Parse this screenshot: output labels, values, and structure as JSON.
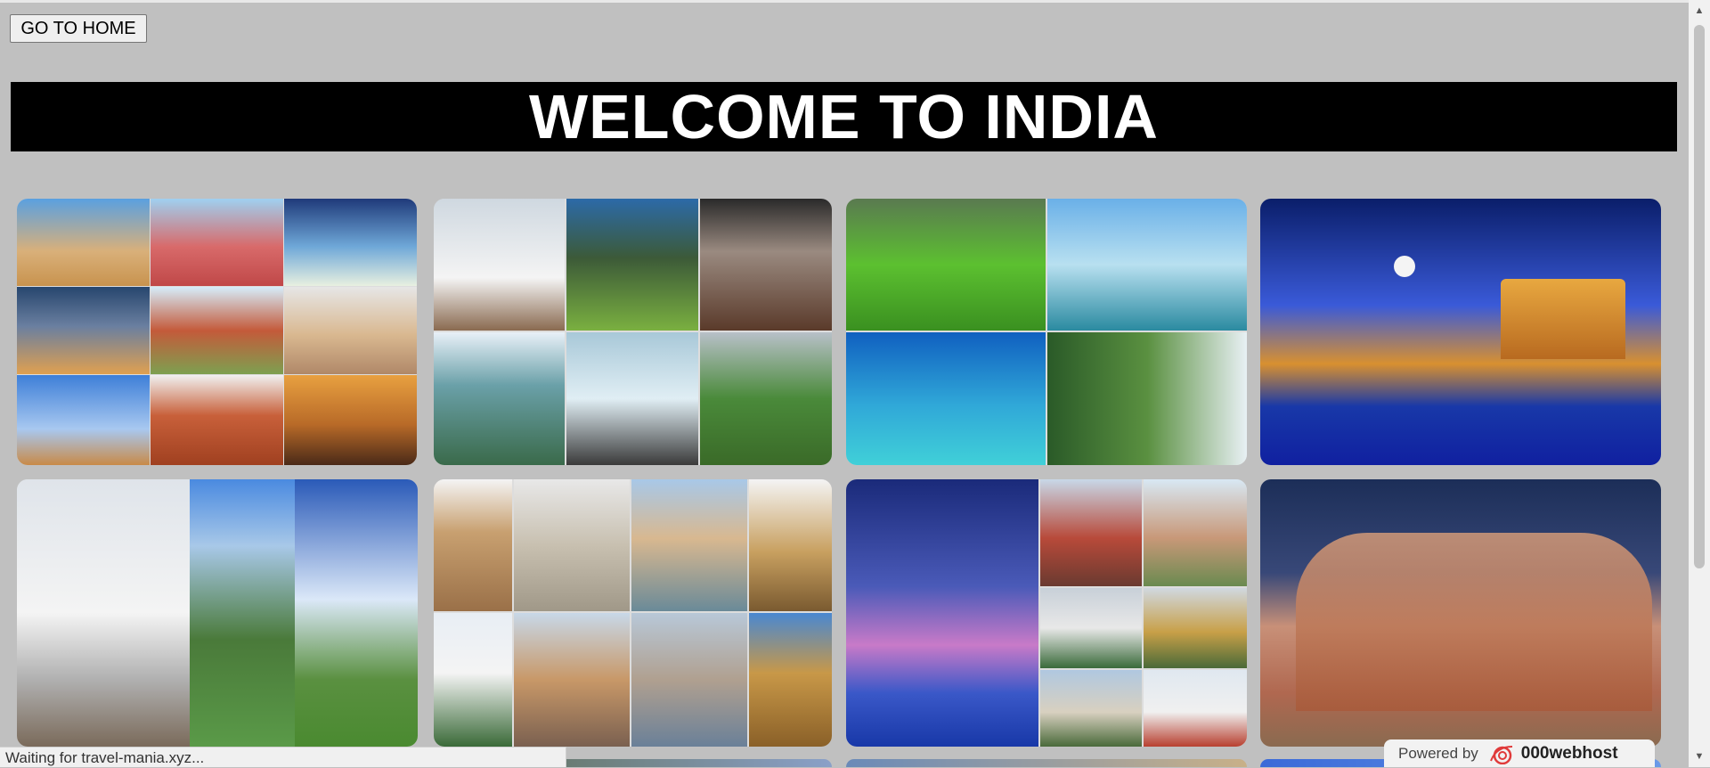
{
  "toolbar": {
    "home_label": "GO TO HOME"
  },
  "header": {
    "title": "WELCOME TO INDIA"
  },
  "gallery": {
    "cards": [
      {
        "name": "delhi-collage"
      },
      {
        "name": "kashmir-collage"
      },
      {
        "name": "kerala-collage"
      },
      {
        "name": "golden-temple"
      },
      {
        "name": "himachal-collage"
      },
      {
        "name": "mumbai-collage"
      },
      {
        "name": "kolkata-collage"
      },
      {
        "name": "kalna-temples"
      }
    ]
  },
  "status": {
    "text": "Waiting for travel-mania.xyz..."
  },
  "footer": {
    "powered_label": "Powered by",
    "brand": "000webhost"
  }
}
